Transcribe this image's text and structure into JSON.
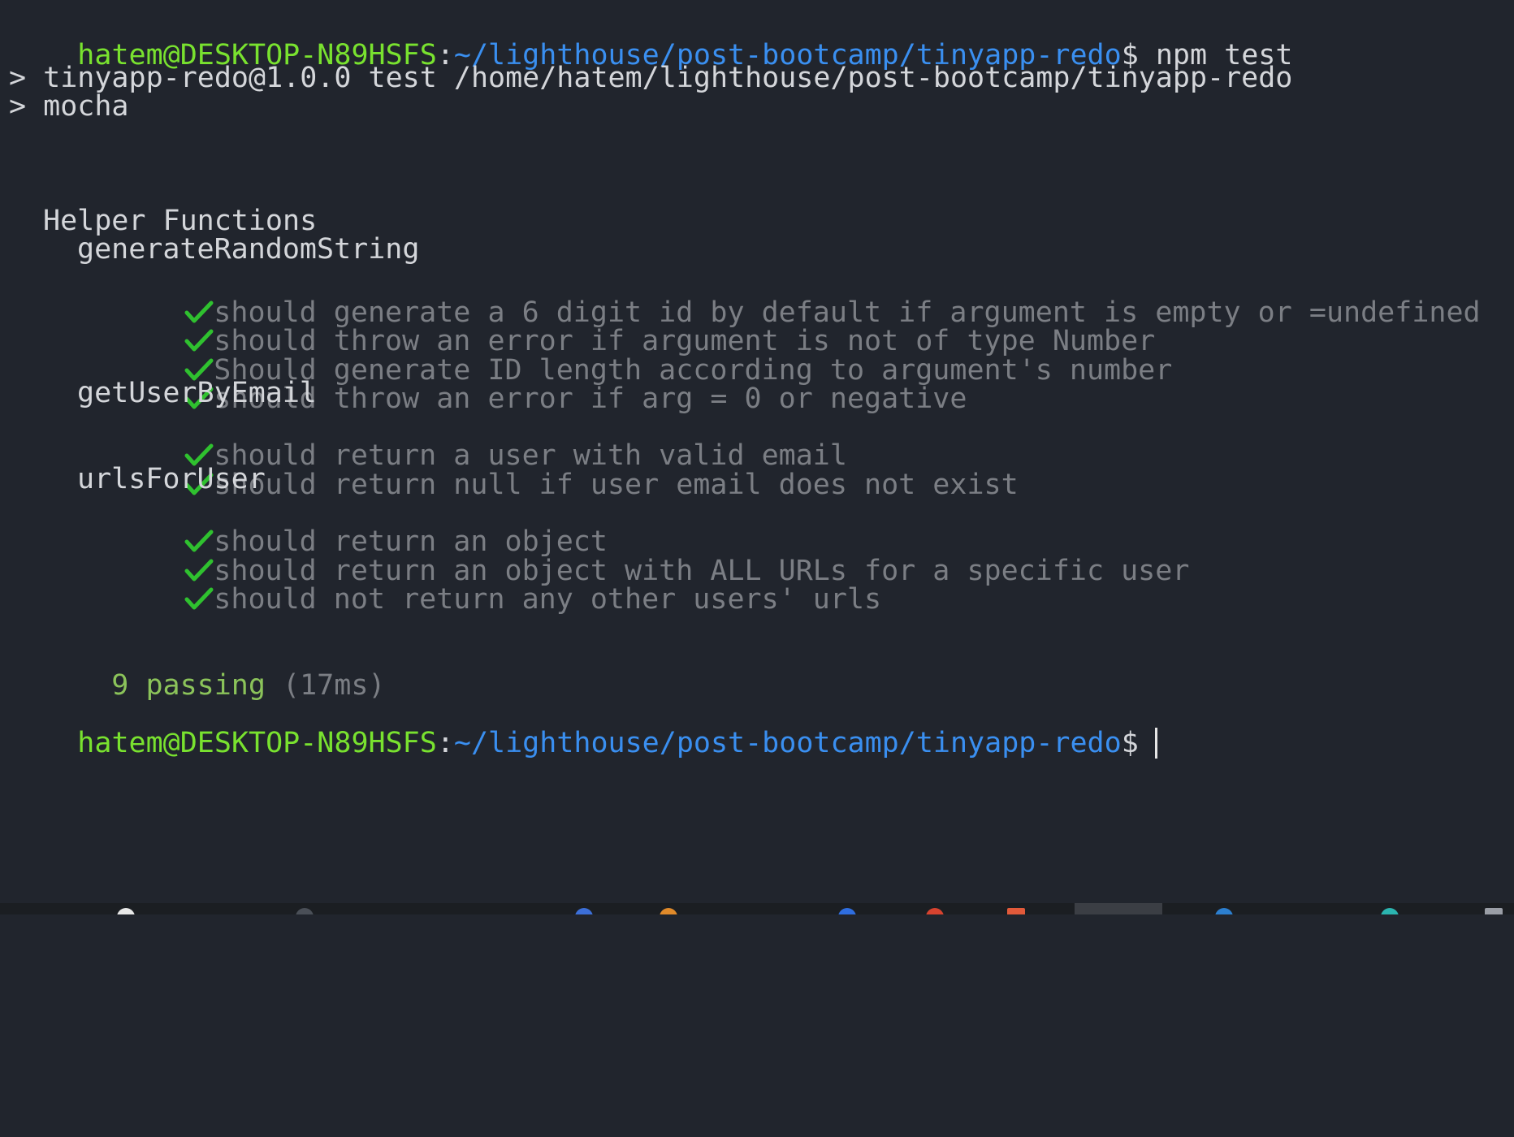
{
  "prompt": {
    "user_host": "hatem@DESKTOP-N89HSFS",
    "separator": ":",
    "path": "~/lighthouse/post-bootcamp/tinyapp-redo",
    "dollar": "$",
    "command": " npm test"
  },
  "npm_output": {
    "line1": "> tinyapp-redo@1.0.0 test /home/hatem/lighthouse/post-bootcamp/tinyapp-redo",
    "line2": "> mocha"
  },
  "suite": {
    "title": "Helper Functions",
    "groups": [
      {
        "name": "generateRandomString",
        "tests": [
          "should generate a 6 digit id by default if argument is empty or =undefined",
          "should throw an error if argument is not of type Number",
          "Should generate ID length according to argument's number",
          "should throw an error if arg = 0 or negative"
        ]
      },
      {
        "name": "getUserByEmail",
        "tests": [
          "should return a user with valid email",
          "should return null if user email does not exist"
        ]
      },
      {
        "name": "urlsForUser",
        "tests": [
          "should return an object",
          "should return an object with ALL URLs for a specific user",
          "should not return any other users' urls"
        ]
      }
    ]
  },
  "summary": {
    "passing": "9 passing",
    "duration": "(17ms)"
  },
  "colors": {
    "background": "#21252d",
    "user_host": "#79e22f",
    "path": "#3a8ff0",
    "check": "#2fc12f",
    "test_text": "#7b7e84",
    "passing": "#8bc35a"
  }
}
